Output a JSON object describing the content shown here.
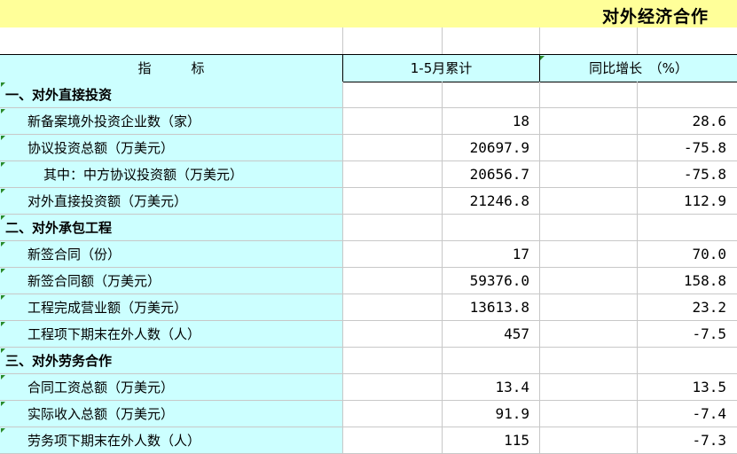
{
  "title": "对外经济合作",
  "header": {
    "indicator": "指　　　标",
    "cumulative": "1-5月累计",
    "yoy": "同比增长　（%）"
  },
  "rows": [
    {
      "label": "一、对外直接投资",
      "kind": "section",
      "value": "",
      "growth": ""
    },
    {
      "label": "新备案境外投资企业数（家）",
      "kind": "item",
      "value": "18",
      "growth": "28.6"
    },
    {
      "label": "协议投资总额（万美元）",
      "kind": "item",
      "value": "20697.9",
      "growth": "-75.8"
    },
    {
      "label": "其中：中方协议投资额（万美元）",
      "kind": "sub",
      "value": "20656.7",
      "growth": "-75.8"
    },
    {
      "label": "对外直接投资额（万美元）",
      "kind": "item",
      "value": "21246.8",
      "growth": "112.9"
    },
    {
      "label": "二、对外承包工程",
      "kind": "section",
      "value": "",
      "growth": ""
    },
    {
      "label": "新签合同（份）",
      "kind": "item",
      "value": "17",
      "growth": "70.0"
    },
    {
      "label": "新签合同额（万美元）",
      "kind": "item",
      "value": "59376.0",
      "growth": "158.8"
    },
    {
      "label": "工程完成营业额（万美元）",
      "kind": "item",
      "value": "13613.8",
      "growth": "23.2"
    },
    {
      "label": "工程项下期末在外人数（人）",
      "kind": "item",
      "value": "457",
      "growth": "-7.5"
    },
    {
      "label": "三、对外劳务合作",
      "kind": "section",
      "value": "",
      "growth": ""
    },
    {
      "label": "合同工资总额（万美元）",
      "kind": "item",
      "value": "13.4",
      "growth": "13.5"
    },
    {
      "label": "实际收入总额（万美元）",
      "kind": "item",
      "value": "91.9",
      "growth": "-7.4"
    },
    {
      "label": "劳务项下期末在外人数（人）",
      "kind": "item",
      "value": "115",
      "growth": "-7.3"
    }
  ]
}
